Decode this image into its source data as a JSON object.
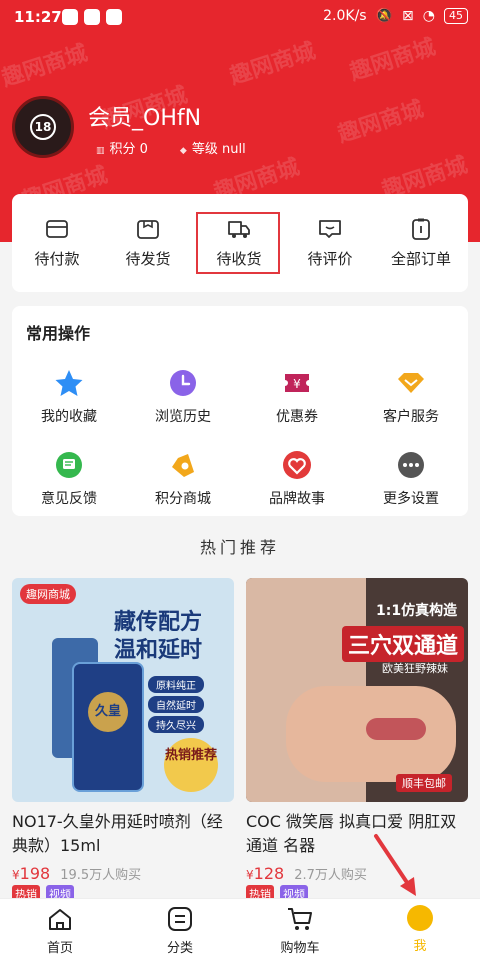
{
  "status_bar": {
    "time": "11:27",
    "speed": "2.0K/s",
    "battery": "45"
  },
  "header": {
    "watermark": "趣网商城",
    "username": "会员_OHfN",
    "points": "积分 0",
    "level": "等级 null",
    "avatar_badge": "18"
  },
  "orders": [
    {
      "label": "待付款",
      "icon": "wallet-icon"
    },
    {
      "label": "待发货",
      "icon": "box-icon"
    },
    {
      "label": "待收货",
      "icon": "truck-icon"
    },
    {
      "label": "待评价",
      "icon": "comment-icon"
    },
    {
      "label": "全部订单",
      "icon": "clipboard-icon"
    }
  ],
  "common": {
    "title": "常用操作",
    "items": [
      {
        "label": "我的收藏",
        "icon": "star-icon",
        "color": "#2e8ef5"
      },
      {
        "label": "浏览历史",
        "icon": "clock-icon",
        "color": "#8a63e8"
      },
      {
        "label": "优惠券",
        "icon": "coupon-icon",
        "color": "#c0245a"
      },
      {
        "label": "客户服务",
        "icon": "diamond-icon",
        "color": "#f2a71b"
      },
      {
        "label": "意见反馈",
        "icon": "feedback-icon",
        "color": "#35b84e"
      },
      {
        "label": "积分商城",
        "icon": "bag-icon",
        "color": "#f2a71b"
      },
      {
        "label": "品牌故事",
        "icon": "heart-icon",
        "color": "#e23a3a"
      },
      {
        "label": "更多设置",
        "icon": "more-icon",
        "color": "#555555"
      }
    ]
  },
  "hot_title": "热门推荐",
  "products": [
    {
      "title": "NO17-久皇外用延时喷剂（经典款）15ml",
      "price": "198",
      "sold": "19.5万人购买",
      "tags": [
        "热销",
        "视频"
      ],
      "img": {
        "brand": "趣网商城",
        "headline1": "藏传配方",
        "headline2": "温和延时",
        "bullets": [
          "原料纯正",
          "自然延时",
          "持久尽兴"
        ],
        "badge": "热销推荐",
        "bottle": "久皇"
      }
    },
    {
      "title": "COC 微笑唇 拟真口爱 阴肛双通道 名器",
      "price": "128",
      "sold": "2.7万人购买",
      "tags": [
        "热销",
        "视频"
      ],
      "img": {
        "top": "1:1仿真构造",
        "headline": "三穴双通道",
        "sub": "欧美狂野辣妹",
        "badge": "顺丰包邮"
      }
    }
  ],
  "tabbar": [
    {
      "label": "首页",
      "icon": "home-icon"
    },
    {
      "label": "分类",
      "icon": "category-icon"
    },
    {
      "label": "购物车",
      "icon": "cart-icon"
    },
    {
      "label": "我",
      "icon": "me-icon"
    }
  ],
  "colors": {
    "brand_red": "#e6262d",
    "accent_yellow": "#f6b800",
    "price_red": "#e2373d"
  }
}
